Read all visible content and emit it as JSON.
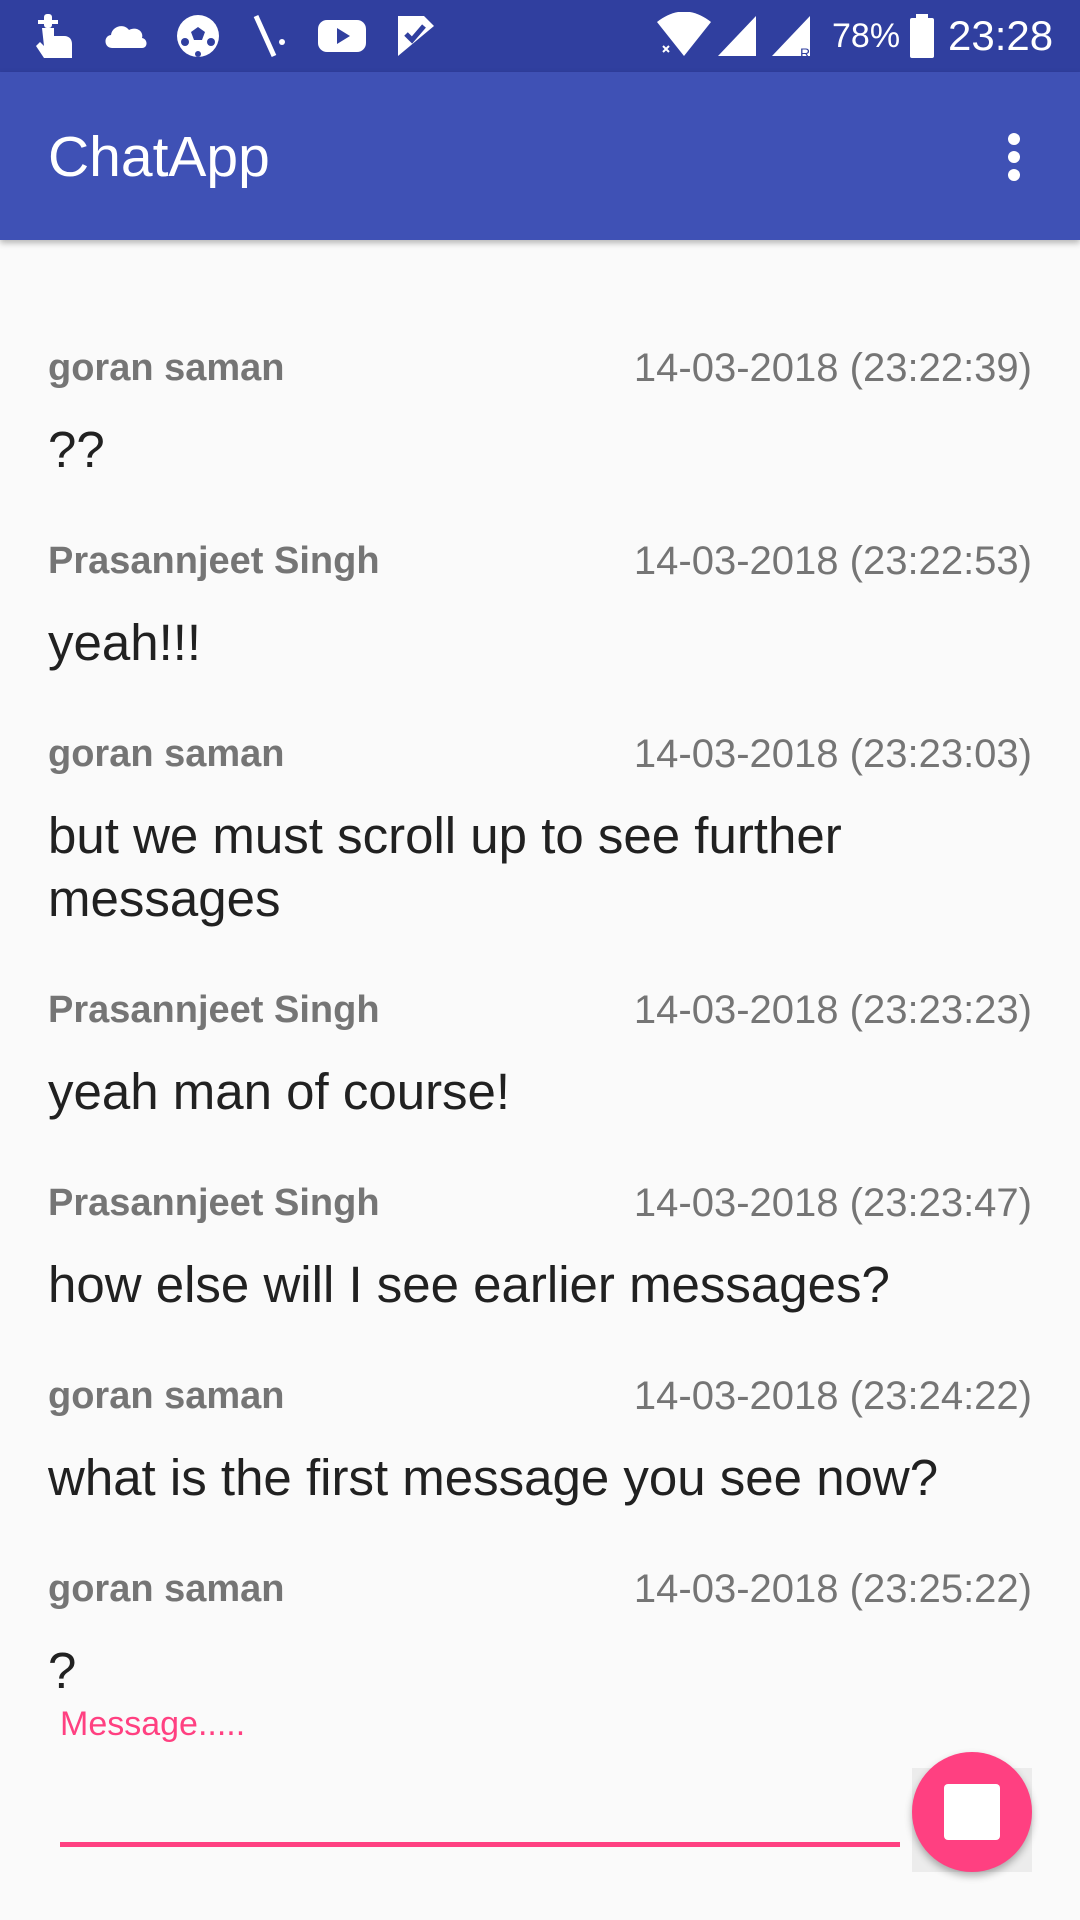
{
  "status_bar": {
    "battery_percent": "78%",
    "time": "23:28",
    "icons": [
      "gesture-icon",
      "cloud-icon",
      "football-icon",
      "cricket-icon",
      "youtube-icon",
      "task-check-icon",
      "wifi-icon",
      "signal-icon",
      "signal-roaming-icon",
      "battery-icon"
    ]
  },
  "app_bar": {
    "title": "ChatApp",
    "overflow_icon": "more-vert-icon"
  },
  "messages": [
    {
      "sender": "goran saman",
      "timestamp": "14-03-2018 (23:22:39)",
      "text": "??"
    },
    {
      "sender": "Prasannjeet Singh",
      "timestamp": "14-03-2018 (23:22:53)",
      "text": "yeah!!!"
    },
    {
      "sender": "goran saman",
      "timestamp": "14-03-2018 (23:23:03)",
      "text": "but we must scroll up to see further messages"
    },
    {
      "sender": "Prasannjeet Singh",
      "timestamp": "14-03-2018 (23:23:23)",
      "text": "yeah man of course!"
    },
    {
      "sender": "Prasannjeet Singh",
      "timestamp": "14-03-2018 (23:23:47)",
      "text": "how else will I see earlier messages?"
    },
    {
      "sender": "goran saman",
      "timestamp": "14-03-2018 (23:24:22)",
      "text": "what is the first message you see now?"
    },
    {
      "sender": "goran saman",
      "timestamp": "14-03-2018 (23:25:22)",
      "text": "?"
    }
  ],
  "composer": {
    "label": "Message.....",
    "value": "",
    "send_icon": "stop-square-icon"
  },
  "colors": {
    "status_bar": "#303f9f",
    "app_bar": "#3f51b5",
    "accent": "#ff4081",
    "background": "#fafafa",
    "meta_text": "#757575",
    "body_text": "#212121"
  }
}
